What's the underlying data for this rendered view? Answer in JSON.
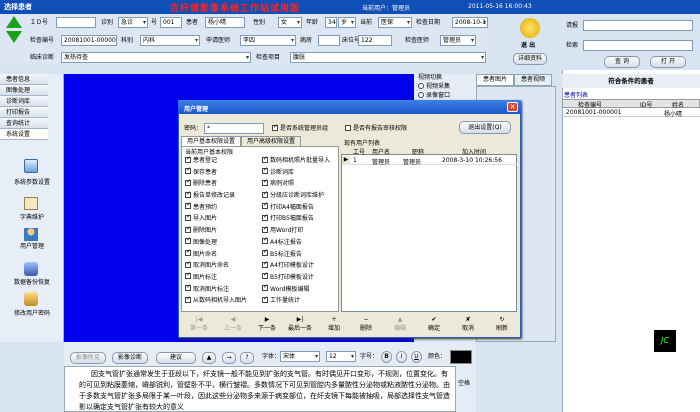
{
  "header": {
    "left_title": "选择患者",
    "title": "吉纤镜影像系统工作站试用版",
    "user_label": "当前用户：管理员",
    "datetime": "2011-05-16 16:00:43"
  },
  "patient": {
    "id_label": "ＩＤ号",
    "id_value": "",
    "diag_label": "诊别",
    "diag_value": "急诊",
    "num_label": "号",
    "num_value": "001",
    "name_label": "患者",
    "name_value": "杨小晴",
    "sex_label": "性别",
    "sex_value": "女",
    "age_label": "年龄",
    "age_value": "34",
    "age_unit": "岁",
    "status_label": "当前",
    "status_value": "医保",
    "exam_date_label": "检查日期",
    "exam_date_value": "2008-10-1",
    "exam_no_label": "检查编号",
    "exam_no_value": "20081001-000001",
    "dept_label": "科别",
    "dept_value": "内科",
    "doctor_label": "申请医师",
    "doctor_value": "李四",
    "room_label": "病房",
    "room_value": "",
    "bed_label": "床位号",
    "bed_value": "122",
    "examiner_label": "检查医师",
    "examiner_value": "管理员",
    "clinical_label": "临床诊断",
    "clinical_value": "发热待查",
    "project_label": "检查项目",
    "project_value": "腹胱"
  },
  "right_panel": {
    "exit_label": "退 出",
    "detail_label": "详细资料",
    "report_label": "请报",
    "query_label": "检索",
    "query_button": "查 询",
    "print_button": "打 开"
  },
  "menu": [
    "患者信息",
    "图像处理",
    "诊断词库",
    "打印报告",
    "查询统计",
    "系统设置"
  ],
  "sidebar": [
    "系统参数设置",
    "字典维护",
    "用户管理",
    "数据备份恢复",
    "修改用户密码"
  ],
  "video": {
    "title": "视频切换",
    "opt1": "视频采集",
    "opt2": "录像窗口"
  },
  "tabs": [
    "患者图片",
    "患者视频"
  ],
  "result": {
    "title": "符合条件的患者",
    "list_label": "患者列表",
    "cols": [
      "检查编号",
      "ID号",
      "姓名"
    ],
    "rows": [
      [
        "20081001-000001",
        "",
        "杨小晴"
      ]
    ]
  },
  "dialog": {
    "title": "用户管理",
    "pwd_label": "密码：",
    "pwd_value": "*",
    "admin_group": "是否系统管理员组",
    "audit": "是否有报告审核权限",
    "exit_btn": "退出设置(Q)",
    "tabs": [
      "用户基本权限设置",
      "用户高级权限设置"
    ],
    "group_title": "当前用户基本权限",
    "perm_left": [
      "患者登记",
      "保存患者",
      "删除患者",
      "报告单修改记录",
      "患者预约",
      "导入图片",
      "删除图片",
      "图像处理",
      "图片命名",
      "取消图片命名",
      "图片标注",
      "取消图片标注",
      "从数码相机导入图片"
    ],
    "perm_right": [
      "数码相机照片批量导入",
      "诊断词库",
      "病例对照",
      "分级应诊断词库维护",
      "打印A4幅面报告",
      "打印B5幅面报告",
      "用Word打印",
      "A4标注报告",
      "B5标注报告",
      "A4打印模板设计",
      "B5打印模板设计",
      "Word模板编辑",
      "工作量统计"
    ],
    "users_title": "现有用户列表",
    "cols": [
      "工号",
      "用户名",
      "职称",
      "加入时间"
    ],
    "users": [
      [
        "1",
        "管理员",
        "管理员",
        "2008-3-10 10:26:56"
      ]
    ],
    "nav": [
      "第一条",
      "上一条",
      "下一条",
      "最后一条",
      "增加",
      "删除",
      "编辑",
      "确定",
      "取消",
      "刷新"
    ]
  },
  "editor": {
    "buttons": [
      "影像所见",
      "影像诊断",
      "建议"
    ],
    "font_label": "字体：",
    "font_value": "宋体",
    "size_label": "字号：",
    "size_value": "12",
    "color_label": "颜色：",
    "bold": "B",
    "italic": "I",
    "underline": "U",
    "side_label": "空格",
    "text": "因支气管扩张通常发生于亚段以下，纤支镜一般不能见到扩张的支气管。有时偶见开口变形，不规则，位置变化。有的可见到粘膜萎缩，嵴部锐利，管壁卧不平，横行皱褶。多数情况下可见到管腔内多量脓性分泌物或粘液脓性分泌物。由于多数支气管扩张多局限于某一叶段，因此这些分泌物多来源于病变部位，在纤支镜下每能被抽吸，局部选择性支气管造影以确定支气管扩张有较大的意义"
  },
  "colors": {
    "accent": "#0000ee",
    "title_red": "#c00000",
    "header_bg": "#b7f0f0"
  }
}
